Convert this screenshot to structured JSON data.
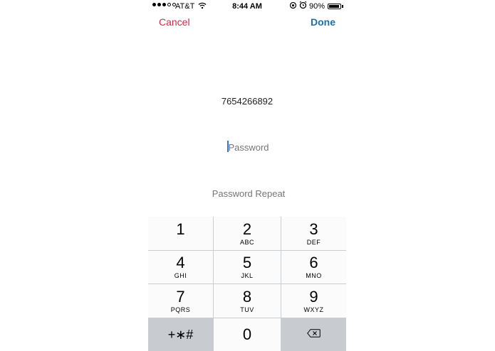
{
  "status_bar": {
    "carrier": "AT&T",
    "time": "8:44 AM",
    "battery_percent": "90%",
    "battery_level": 0.9,
    "signal_bars_filled": 3,
    "signal_bars_total": 5
  },
  "nav": {
    "cancel_label": "Cancel",
    "done_label": "Done",
    "cancel_color": "#d0294b",
    "done_color": "#1e6fa8"
  },
  "form": {
    "phone_number": "7654266892",
    "password_placeholder": "Password",
    "password_repeat_placeholder": "Password Repeat"
  },
  "keypad": {
    "keys": [
      {
        "digit": "1",
        "letters": ""
      },
      {
        "digit": "2",
        "letters": "ABC"
      },
      {
        "digit": "3",
        "letters": "DEF"
      },
      {
        "digit": "4",
        "letters": "GHI"
      },
      {
        "digit": "5",
        "letters": "JKL"
      },
      {
        "digit": "6",
        "letters": "MNO"
      },
      {
        "digit": "7",
        "letters": "PQRS"
      },
      {
        "digit": "8",
        "letters": "TUV"
      },
      {
        "digit": "9",
        "letters": "WXYZ"
      }
    ],
    "symbols_label": "+∗#",
    "zero": "0",
    "delete_icon": "backspace-icon"
  }
}
